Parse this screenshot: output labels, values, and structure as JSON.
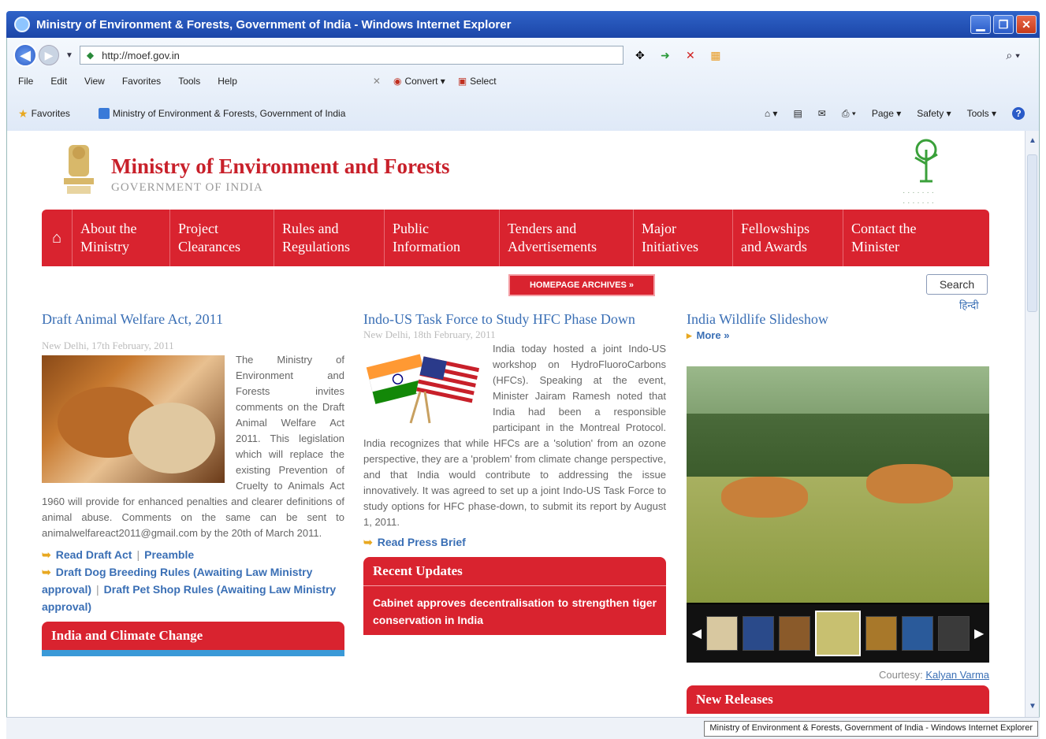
{
  "window": {
    "title": "Ministry of Environment & Forests, Government of India - Windows Internet Explorer",
    "url": "http://moef.gov.in"
  },
  "menu": {
    "items": [
      "File",
      "Edit",
      "View",
      "Favorites",
      "Tools",
      "Help"
    ],
    "convert_label": "Convert",
    "select_label": "Select"
  },
  "favbar": {
    "favorites_label": "Favorites",
    "tab_title": "Ministry of Environment & Forests, Government of India",
    "commands": [
      "Page",
      "Safety",
      "Tools"
    ]
  },
  "site": {
    "title": "Ministry of Environment and Forests",
    "subtitle": "GOVERNMENT OF INDIA",
    "nav": [
      {
        "line1": "About the",
        "line2": "Ministry"
      },
      {
        "line1": "Project",
        "line2": "Clearances"
      },
      {
        "line1": "Rules and",
        "line2": "Regulations"
      },
      {
        "line1": "Public",
        "line2": "Information"
      },
      {
        "line1": "Tenders and",
        "line2": "Advertisements"
      },
      {
        "line1": "Major",
        "line2": "Initiatives"
      },
      {
        "line1": "Fellowships",
        "line2": "and Awards"
      },
      {
        "line1": "Contact the",
        "line2": "Minister"
      }
    ],
    "archives_label": "HOMEPAGE ARCHIVES »",
    "search_label": "Search",
    "hindi_label": "हिन्दी"
  },
  "col1": {
    "headline": "Draft Animal Welfare Act, 2011",
    "dateline": "New Delhi, 17th February, 2011",
    "body": "The Ministry of Environment and Forests invites comments on the Draft Animal Welfare Act 2011. This legislation which will replace the existing Prevention of Cruelty to Animals Act 1960 will provide for enhanced penalties and clearer definitions of animal abuse. Comments on the same can be sent to animalwelfareact2011@gmail.com by the 20th of March 2011.",
    "link1": "Read Draft Act",
    "link2": "Preamble",
    "link3": "Draft Dog Breeding Rules (Awaiting Law Ministry approval)",
    "link4": "Draft Pet Shop Rules (Awaiting Law Ministry approval)",
    "panel_title": "India and Climate Change"
  },
  "col2": {
    "headline": "Indo-US Task Force to Study HFC Phase Down",
    "dateline": "New Delhi, 18th February, 2011",
    "body": "India today hosted a joint Indo-US workshop on HydroFluoroCarbons (HFCs). Speaking at the event, Minister Jairam Ramesh noted that India had been a responsible participant in the Montreal Protocol. India recognizes that while HFCs are a 'solution' from an ozone perspective, they are a 'problem' from climate change perspective, and that India would contribute to addressing the issue innovatively. It was agreed to set up a joint Indo-US Task Force to study options for HFC phase-down, to submit its report by August 1, 2011.",
    "link": "Read Press Brief",
    "panel_title": "Recent Updates",
    "update_item": "Cabinet approves decentralisation to strengthen tiger conservation in India"
  },
  "col3": {
    "headline": "India Wildlife Slideshow",
    "more_label": "More »",
    "courtesy_label": "Courtesy:",
    "courtesy_name": "Kalyan Varma",
    "panel_title": "New Releases"
  },
  "status": {
    "tooltip": "Ministry of Environment & Forests, Government of India - Windows Internet Explorer"
  }
}
